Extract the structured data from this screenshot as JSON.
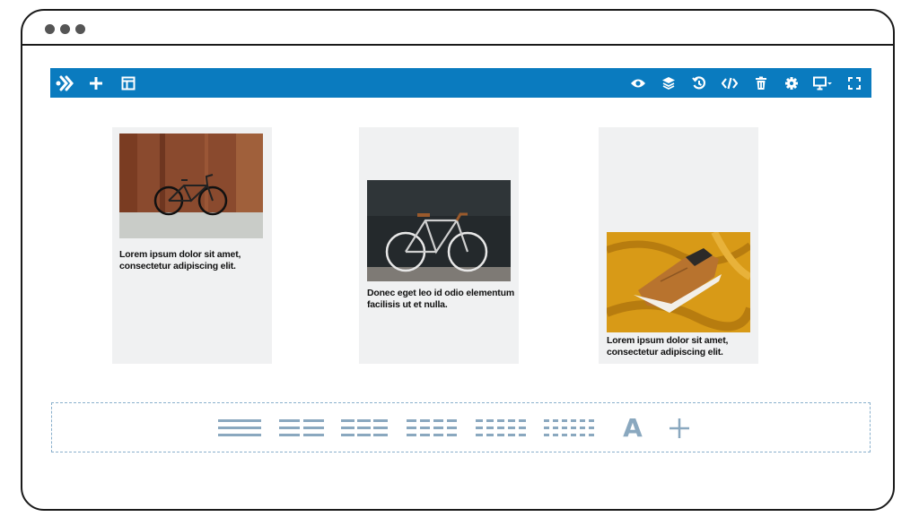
{
  "window": {
    "dots": [
      "dot",
      "dot",
      "dot"
    ]
  },
  "toolbar": {
    "color": "#0a7bbf",
    "left_icons": [
      "logo-icon",
      "add-icon",
      "layout-icon"
    ],
    "right_icons": [
      "preview-eye-icon",
      "layers-icon",
      "history-icon",
      "code-icon",
      "trash-icon",
      "settings-gear-icon",
      "device-desktop-icon",
      "fullscreen-icon"
    ]
  },
  "columns": [
    {
      "image": "bicycle-against-rusty-wall",
      "caption": "Lorem ipsum dolor sit amet, consectetur adipiscing elit.",
      "align": "top"
    },
    {
      "image": "bicycle-against-dark-wall",
      "caption": "Donec eget leo id odio elementum facilisis ut et nulla.",
      "align": "middle"
    },
    {
      "image": "sneaker-on-yellow-fabric",
      "caption": "Lorem ipsum dolor sit amet, consectetur adipiscing elit.",
      "align": "bottom"
    }
  ],
  "block_bar": {
    "border_color": "#8ab0cc",
    "icon_color": "#8aa8bf",
    "items": [
      "one-column-icon",
      "two-column-icon",
      "three-column-icon",
      "four-column-icon",
      "five-column-icon",
      "six-column-icon",
      "text-block-icon",
      "add-block-icon"
    ],
    "text_glyph": "A"
  }
}
